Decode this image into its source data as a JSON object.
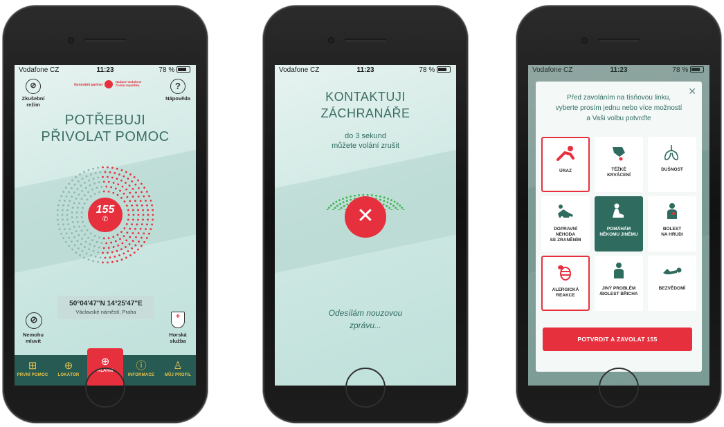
{
  "status": {
    "carrier": "Vodafone CZ",
    "time": "11:23",
    "battery": "78 %"
  },
  "screen1": {
    "test_mode": "Zkušební\nrežim",
    "partner": "Generální partner",
    "partner_org": "Nadace Vodafone Česká republika",
    "help": "Nápověda",
    "title_line1": "POTŘEBUJI",
    "title_line2": "PŘIVOLAT POMOC",
    "call_number": "155",
    "coords": "50°04'47\"N 14°25'47\"E",
    "address": "Václavské náměstí, Praha",
    "mute_label": "Nemohu\nmluvit",
    "mountain_label": "Horská\nslužba",
    "tabs": [
      "PRVNÍ POMOC",
      "LOKÁTOR",
      "ALARM",
      "INFORMACE",
      "MŮJ PROFIL"
    ]
  },
  "screen2": {
    "title_line1": "KONTAKTUJI",
    "title_line2": "ZÁCHRANÁŘE",
    "sub_line1": "do 3 sekund",
    "sub_line2": "můžete volání zrušit",
    "sending_line1": "Odesílám nouzovou",
    "sending_line2": "zprávu..."
  },
  "screen3": {
    "head_line1": "Před zavoláním na tísňovou linku,",
    "head_line2": "vyberte prosím jednu nebo více možností",
    "head_line3": "a Vaši volbu potvrďte",
    "tiles": [
      "ÚRAZ",
      "TĚŽKÉ\nKRVÁCENÍ",
      "DUŠNOST",
      "DOPRAVNÍ\nNEHODA\nSE ZRANĚNÍM",
      "POMÁHÁM\nNĚKOMU JINÉMU",
      "BOLEST\nNA HRUDI",
      "ALERGICKÁ\nREAKCE",
      "JINÝ PROBLÉM\n/BOLEST BŘICHA",
      "BEZVĚDOMÍ"
    ],
    "confirm": "POTVRDIT A ZAVOLAT 155"
  },
  "colors": {
    "accent": "#e6303e",
    "teal": "#2f6b61",
    "tab_bg": "#275a52",
    "tab_icon": "#e9c24a"
  }
}
